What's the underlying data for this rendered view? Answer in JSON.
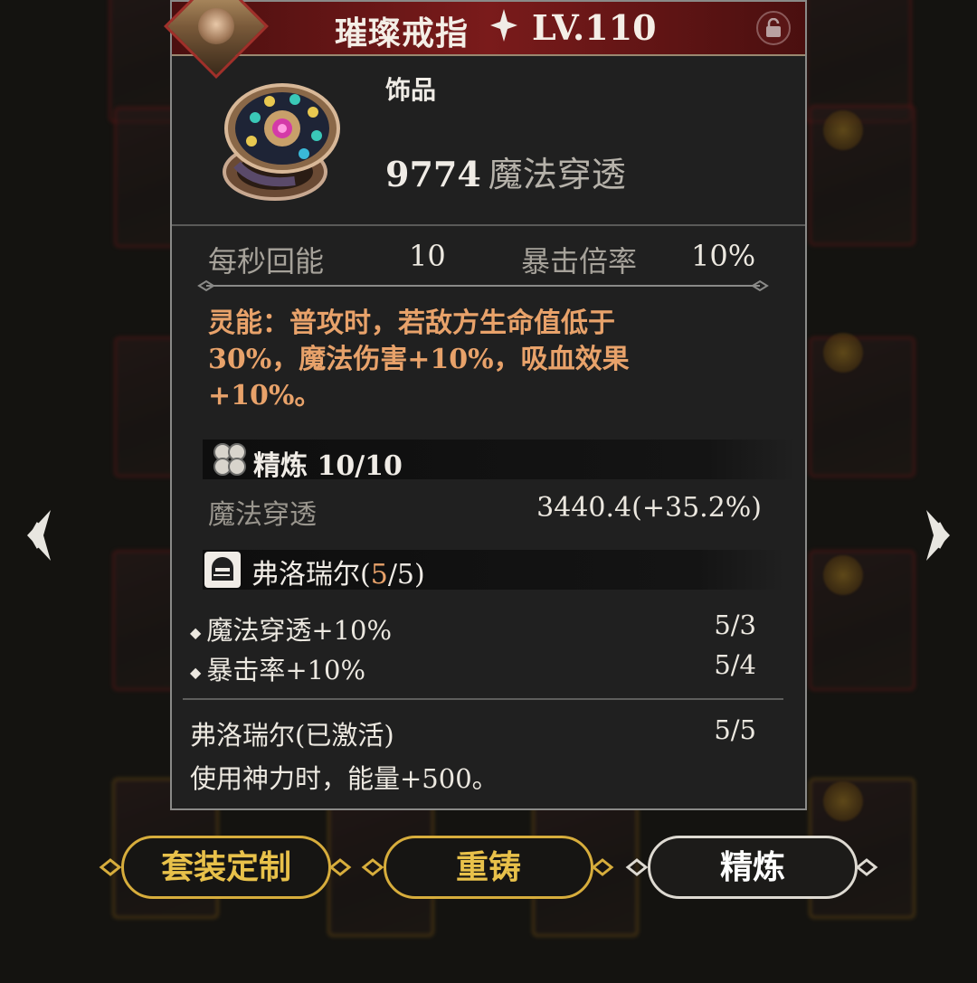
{
  "item": {
    "name": "璀璨戒指",
    "level": "LV.110",
    "type": "饰品",
    "main_stat_value": "9774",
    "main_stat_name": "魔法穿透"
  },
  "stats": [
    {
      "label": "每秒回能",
      "value": "10"
    },
    {
      "label": "暴击倍率",
      "value": "10%"
    }
  ],
  "psionic": {
    "lines": [
      "灵能：普攻时，若敌方生命值低于",
      "30%，魔法伤害+10%，吸血效果",
      "+10%。"
    ]
  },
  "refine": {
    "title": "精炼 10/10",
    "stat_name": "魔法穿透",
    "stat_value": "3440.4(+35.2%)"
  },
  "set": {
    "name": "弗洛瑞尔",
    "paren_open": "(",
    "count": "5",
    "total": "/5)",
    "bonuses": [
      {
        "text": "魔法穿透+10%",
        "req": "5/3"
      },
      {
        "text": "暴击率+10%",
        "req": "5/4"
      }
    ],
    "activated_label": "弗洛瑞尔(已激活)",
    "activated_count": "5/5",
    "activated_desc": "使用神力时，能量+500。"
  },
  "buttons": {
    "set_custom": "套装定制",
    "reforge": "重铸",
    "refine": "精炼"
  },
  "icons": {
    "lock": "lock-icon",
    "sparkle": "sparkle-icon",
    "nav_left": "chevron-left-icon",
    "nav_right": "chevron-right-icon"
  },
  "colors": {
    "header": "#7a1b1b",
    "panel": "#202020",
    "psionic_text": "#e8a26a",
    "set_count": "#e8a26a",
    "gold_button": "#d7ad3c"
  }
}
